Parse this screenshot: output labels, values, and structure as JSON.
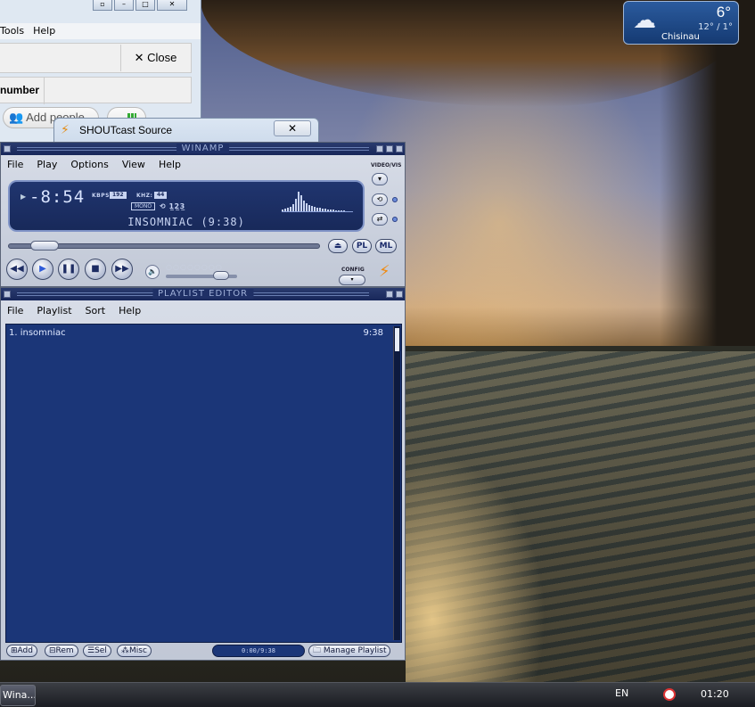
{
  "weather": {
    "temp": "6°",
    "range": "12° / 1°",
    "city": "Chisinau",
    "icon": "snow-cloud-icon"
  },
  "background_window": {
    "menu": [
      "Tools",
      "Help"
    ],
    "close_label": "Close",
    "column_header": "number",
    "add_people_label": "Add people"
  },
  "shoutcast": {
    "title": "SHOUTcast Source",
    "close_glyph": "✕"
  },
  "winamp": {
    "title": "WINAMP",
    "menu": [
      "File",
      "Play",
      "Options",
      "View",
      "Help"
    ],
    "time": "-8:54",
    "kbps_label": "KBPS:",
    "kbps": "192",
    "khz_label": "KHZ:",
    "khz": "44",
    "mono_label": "MONO",
    "track_display": "INSOMNIAC (9:38)",
    "video_vis_label": "VIDEO/VIS",
    "eject": "⏏",
    "pl_label": "PL",
    "ml_label": "ML",
    "config_label": "CONFIG",
    "seek_fraction": 0.08,
    "volume_fraction": 0.85
  },
  "playlist": {
    "title": "PLAYLIST EDITOR",
    "menu": [
      "File",
      "Playlist",
      "Sort",
      "Help"
    ],
    "items": [
      {
        "label": "1. insomniac",
        "duration": "9:38"
      }
    ],
    "time_display": "0:00/9:38",
    "buttons": {
      "add": "Add",
      "rem": "Rem",
      "sel": "Sel",
      "misc": "Misc",
      "manage": "Manage Playlist"
    }
  },
  "taskbar": {
    "task_label": "Wina...",
    "language": "EN",
    "clock": "01:20"
  }
}
